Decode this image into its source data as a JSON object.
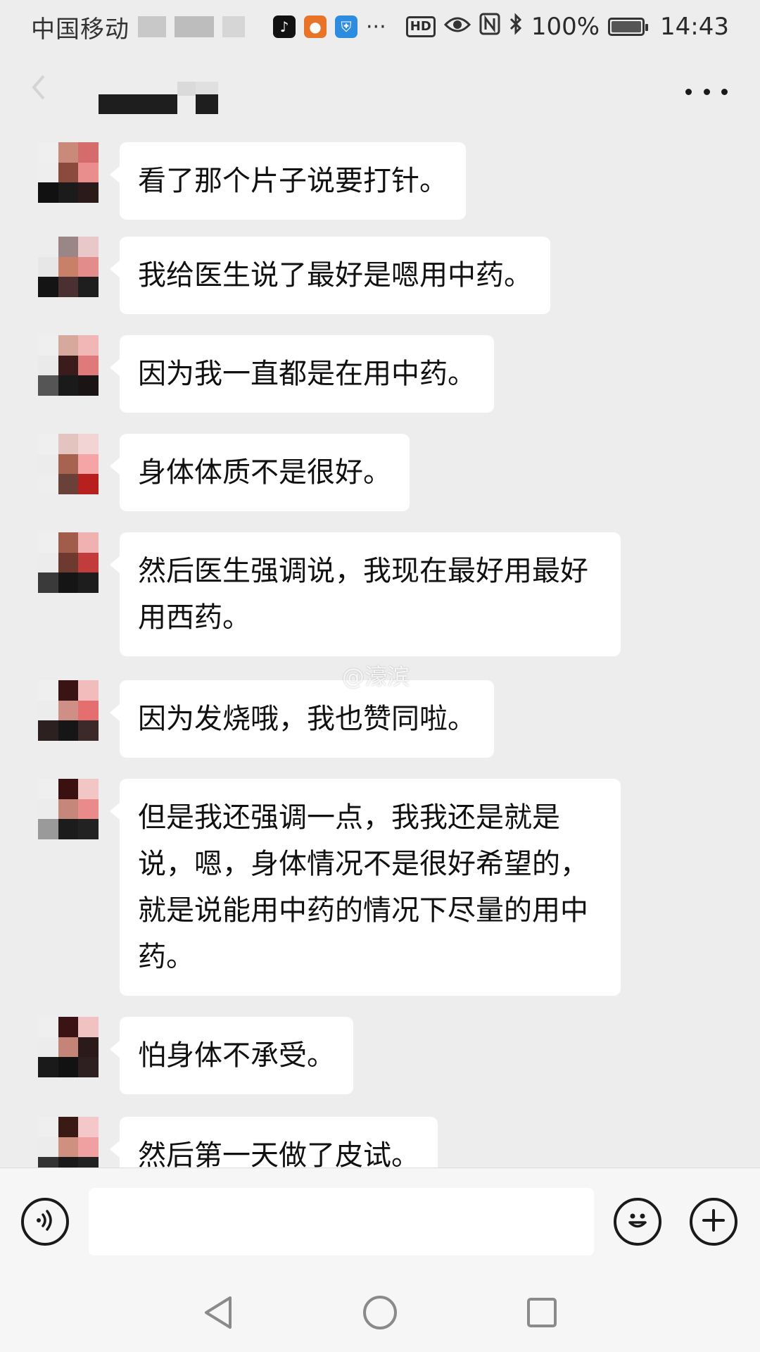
{
  "status_bar": {
    "carrier": "中国移动",
    "battery_percent": "100%",
    "time": "14:43",
    "hd_label": "HD",
    "icons": [
      "tiktok-icon",
      "fox-icon",
      "shield-icon",
      "more-dots-icon",
      "eye-icon",
      "nfc-icon",
      "bluetooth-icon",
      "battery-icon"
    ]
  },
  "header": {
    "more_icon": "more-dots-icon"
  },
  "watermark": "@濠滨",
  "messages": [
    {
      "text": "看了那个片子说要打针。"
    },
    {
      "text": "我给医生说了最好是嗯用中药。"
    },
    {
      "text": "因为我一直都是在用中药。"
    },
    {
      "text": "身体体质不是很好。"
    },
    {
      "text": "然后医生强调说，我现在最好用最好用西药。"
    },
    {
      "text": "因为发烧哦，我也赞同啦。"
    },
    {
      "text": "但是我还强调一点，我我还是就是说，嗯，身体情况不是很好希望的，就是说能用中药的情况下尽量的用中药。"
    },
    {
      "text": "怕身体不承受。"
    },
    {
      "text": "然后第一天做了皮试。"
    }
  ],
  "input_bar": {
    "voice_icon": "voice-icon",
    "emoji_icon": "emoji-icon",
    "plus_icon": "plus-icon",
    "input_value": ""
  },
  "nav_bar": {
    "icons": [
      "nav-back-icon",
      "nav-home-icon",
      "nav-recent-icon"
    ]
  }
}
